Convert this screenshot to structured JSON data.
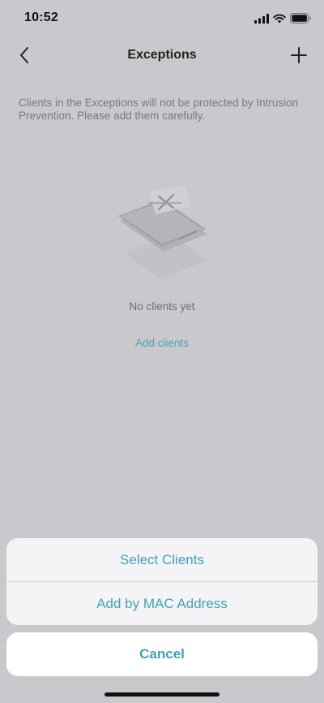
{
  "status_bar": {
    "time": "10:52",
    "icons": [
      "cellular-signal-icon",
      "wifi-icon",
      "battery-icon"
    ]
  },
  "nav": {
    "title": "Exceptions",
    "back_icon": "chevron-left-icon",
    "add_icon": "plus-icon"
  },
  "main": {
    "description": "Clients in the Exceptions will not be protected by Intrusion Prevention. Please add them carefully.",
    "empty_icon": "empty-device-icon",
    "empty_text": "No clients yet",
    "add_clients_link": "Add clients"
  },
  "action_sheet": {
    "options": [
      {
        "label": "Select Clients"
      },
      {
        "label": "Add by MAC Address"
      }
    ],
    "cancel_label": "Cancel"
  },
  "colors": {
    "accent": "#41a0b8",
    "overlay_background": "#c9c9cd",
    "sheet_background": "#f4f4f6",
    "cancel_background": "#ffffff"
  }
}
